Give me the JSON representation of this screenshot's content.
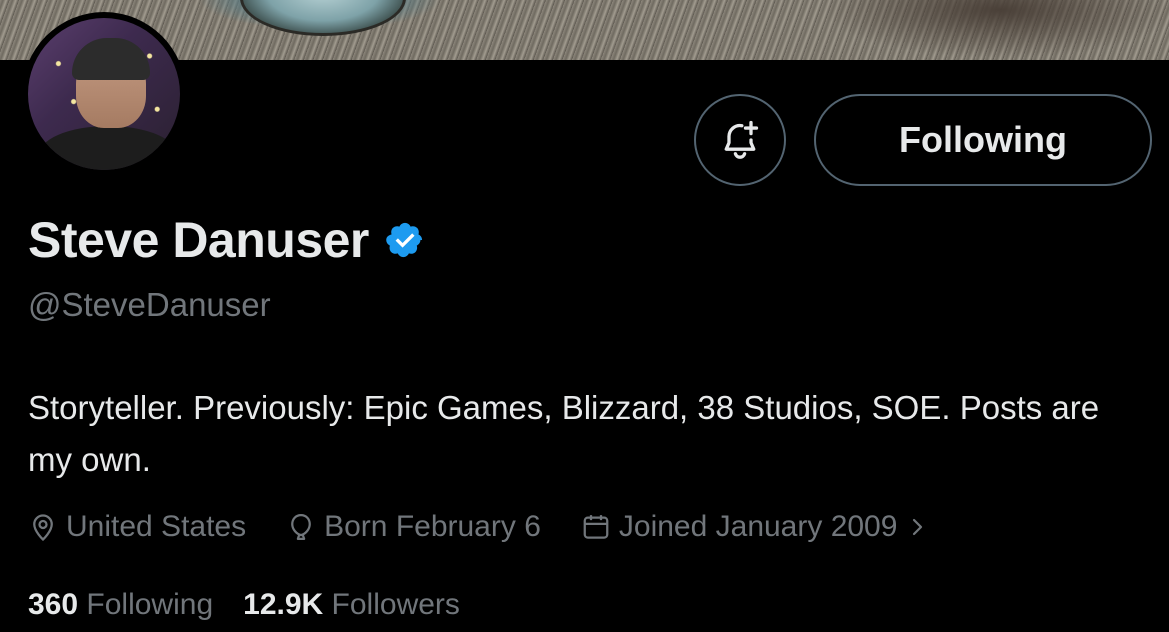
{
  "profile": {
    "name": "Steve Danuser",
    "handle": "@SteveDanuser",
    "verified": true,
    "bio": "Storyteller. Previously: Epic Games, Blizzard, 38 Studios, SOE. Posts are my own.",
    "location": "United States",
    "birthday": "Born February 6",
    "joined": "Joined January 2009",
    "following_count": "360",
    "following_label": "Following",
    "followers_count": "12.9K",
    "followers_label": "Followers"
  },
  "actions": {
    "notify_icon": "bell-plus-icon",
    "follow_button_label": "Following"
  },
  "icons": {
    "verified": "verified-badge-icon",
    "location": "location-pin-icon",
    "birthday": "balloon-icon",
    "joined": "calendar-icon",
    "joined_arrow": "chevron-right-icon"
  },
  "colors": {
    "background": "#000000",
    "text_primary": "#e7e9ea",
    "text_secondary": "#71767b",
    "border": "#536471",
    "verified_blue": "#1d9bf0"
  }
}
